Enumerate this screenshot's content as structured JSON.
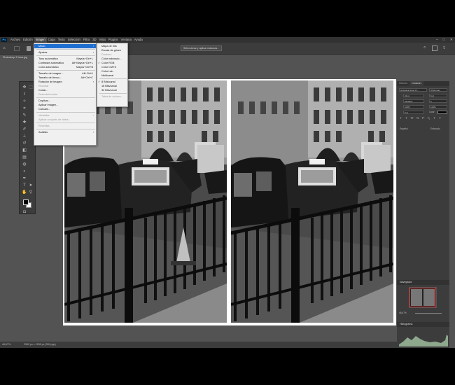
{
  "menubar": {
    "logo": "Ps",
    "items": [
      "Archivo",
      "Edición",
      "Imagen",
      "Capa",
      "Texto",
      "Selección",
      "Filtro",
      "3D",
      "Vista",
      "Plugins",
      "Ventana",
      "Ayuda"
    ],
    "active_index": 2,
    "window_controls": [
      "–",
      "□",
      "✕"
    ]
  },
  "optionsbar": {
    "select_and_mask": "Seleccionar y aplicar máscara..."
  },
  "document": {
    "tab_title": "Photoshop-7 fotos.jpg"
  },
  "image_menu": {
    "items": [
      {
        "label": "Modo",
        "arrow": true,
        "highlight": true
      },
      {
        "sep": true
      },
      {
        "label": "Ajustes",
        "arrow": true
      },
      {
        "sep": true
      },
      {
        "label": "Tono automático",
        "shortcut": "Mayús+Ctrl+L"
      },
      {
        "label": "Contraste automático",
        "shortcut": "Alt+Mayús+Ctrl+L"
      },
      {
        "label": "Color automático",
        "shortcut": "Mayús+Ctrl+B"
      },
      {
        "sep": true
      },
      {
        "label": "Tamaño de imagen...",
        "shortcut": "Alt+Ctrl+I"
      },
      {
        "label": "Tamaño de lienzo...",
        "shortcut": "Alt+Ctrl+C"
      },
      {
        "label": "Rotación de imagen",
        "arrow": true
      },
      {
        "label": "Recortar",
        "disabled": true
      },
      {
        "label": "Cortar..."
      },
      {
        "label": "Descubrir todas",
        "disabled": true
      },
      {
        "sep": true
      },
      {
        "label": "Duplicar..."
      },
      {
        "label": "Aplicar imagen..."
      },
      {
        "label": "Calcular..."
      },
      {
        "sep": true
      },
      {
        "label": "Variables",
        "arrow": true,
        "disabled": true
      },
      {
        "label": "Aplicar conjunto de datos...",
        "disabled": true
      },
      {
        "sep": true
      },
      {
        "label": "Reventar...",
        "disabled": true
      },
      {
        "sep": true
      },
      {
        "label": "Análisis",
        "arrow": true
      }
    ]
  },
  "mode_menu": {
    "items": [
      {
        "label": "Mapa de bits"
      },
      {
        "label": "Escala de grises"
      },
      {
        "label": "Duotono",
        "disabled": true
      },
      {
        "label": "Color indexado..."
      },
      {
        "label": "Color RGB",
        "checked": true
      },
      {
        "label": "Color CMYK"
      },
      {
        "label": "Color Lab"
      },
      {
        "label": "Multicanal"
      },
      {
        "sep": true
      },
      {
        "label": "8 Bits/canal",
        "checked": true
      },
      {
        "label": "16 Bits/canal"
      },
      {
        "label": "32 Bits/canal"
      },
      {
        "sep": true
      },
      {
        "label": "Tabla de colores...",
        "disabled": true
      }
    ]
  },
  "character_panel": {
    "tabs": [
      "Historia",
      "Carácter"
    ],
    "font_family": "Helvetica Neue LT...",
    "font_style": "55 Roman",
    "size": "24 pt",
    "leading": "6 pt",
    "kerning": "Medidas",
    "tracking": "0",
    "vscale": "100%",
    "hscale": "100%",
    "baseline": "0 pt",
    "color_label": "Color:",
    "language": "Español",
    "antialias": "Enfocado",
    "type_buttons": [
      "T",
      "T",
      "TT",
      "Tt",
      "T¹",
      "T₁",
      "T",
      "T"
    ]
  },
  "navigator": {
    "title": "Navegador",
    "zoom": "46,67%"
  },
  "histogram": {
    "title": "Histograma"
  },
  "statusbar": {
    "zoom": "46,67%",
    "doc_info": "2362 px x 1535 px (300 ppp)"
  },
  "colors": {
    "menu_highlight": "#1f6fd1",
    "foreground": "#000000",
    "background": "#ffffff"
  }
}
